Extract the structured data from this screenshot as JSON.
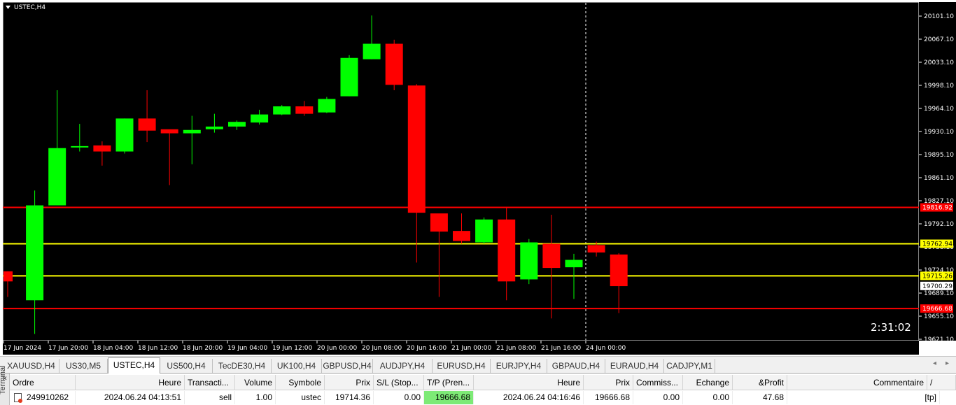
{
  "chart": {
    "symbol_label": "USTEC,H4",
    "countdown": "2:31:02",
    "colors": {
      "background": "#000000",
      "bull": "#00ff00",
      "bear": "#ff0000",
      "axis_text": "#ffffff",
      "crosshair": "#ffffff"
    },
    "price_ticks": [
      "20101.10",
      "20067.10",
      "20033.10",
      "19998.10",
      "19964.10",
      "19930.10",
      "19895.10",
      "19861.10",
      "19827.10",
      "19792.10",
      "19758.10",
      "19724.10",
      "19689.10",
      "19655.10",
      "19621.10"
    ],
    "time_ticks": [
      "17 Jun 2024",
      "17 Jun 20:00",
      "18 Jun 04:00",
      "18 Jun 12:00",
      "18 Jun 20:00",
      "19 Jun 04:00",
      "19 Jun 12:00",
      "20 Jun 00:00",
      "20 Jun 08:00",
      "20 Jun 16:00",
      "21 Jun 00:00",
      "21 Jun 08:00",
      "21 Jun 16:00",
      "24 Jun 00:00"
    ],
    "levels": [
      {
        "label": "19816.92",
        "price": 19816.92,
        "line_color": "#ff0000",
        "tag_bg": "#ff0000",
        "tag_fg": "#ffffff"
      },
      {
        "label": "19762.94",
        "price": 19762.94,
        "line_color": "#ffff00",
        "tag_bg": "#ffff00",
        "tag_fg": "#000000"
      },
      {
        "label": "19715.26",
        "price": 19715.26,
        "line_color": "#ffff00",
        "tag_bg": "#ffff00",
        "tag_fg": "#000000"
      },
      {
        "label": "19666.68",
        "price": 19666.68,
        "line_color": "#ff0000",
        "tag_bg": "#ff0000",
        "tag_fg": "#ffffff"
      }
    ],
    "current_price_tag": "19700.29"
  },
  "chart_data": {
    "type": "candlestick",
    "title": "USTEC,H4",
    "ylim": [
      19621.1,
      20101.1
    ],
    "candles": [
      {
        "o": 19722,
        "h": 19722,
        "l": 19684,
        "c": 19707
      },
      {
        "o": 19679,
        "h": 19842,
        "l": 19629,
        "c": 19820
      },
      {
        "o": 19820,
        "h": 19991,
        "l": 19820,
        "c": 19905
      },
      {
        "o": 19906,
        "h": 19941,
        "l": 19900,
        "c": 19908
      },
      {
        "o": 19909,
        "h": 19915,
        "l": 19879,
        "c": 19900
      },
      {
        "o": 19900,
        "h": 19949,
        "l": 19897,
        "c": 19949
      },
      {
        "o": 19949,
        "h": 19991,
        "l": 19914,
        "c": 19931
      },
      {
        "o": 19933,
        "h": 19932,
        "l": 19850,
        "c": 19927
      },
      {
        "o": 19927,
        "h": 19953,
        "l": 19881,
        "c": 19932
      },
      {
        "o": 19933,
        "h": 19956,
        "l": 19928,
        "c": 19937
      },
      {
        "o": 19937,
        "h": 19946,
        "l": 19932,
        "c": 19944
      },
      {
        "o": 19943,
        "h": 19962,
        "l": 19940,
        "c": 19955
      },
      {
        "o": 19955,
        "h": 19969,
        "l": 19954,
        "c": 19967
      },
      {
        "o": 19967,
        "h": 19975,
        "l": 19953,
        "c": 19956
      },
      {
        "o": 19958,
        "h": 19981,
        "l": 19957,
        "c": 19978
      },
      {
        "o": 19982,
        "h": 20043,
        "l": 19982,
        "c": 20039
      },
      {
        "o": 20037,
        "h": 20102,
        "l": 20037,
        "c": 20060
      },
      {
        "o": 20060,
        "h": 20066,
        "l": 19991,
        "c": 19999
      },
      {
        "o": 19998,
        "h": 20000,
        "l": 19735,
        "c": 19809
      },
      {
        "o": 19808,
        "h": 19806,
        "l": 19684,
        "c": 19781
      },
      {
        "o": 19782,
        "h": 19808,
        "l": 19763,
        "c": 19767
      },
      {
        "o": 19765,
        "h": 19802,
        "l": 19763,
        "c": 19799
      },
      {
        "o": 19799,
        "h": 19817,
        "l": 19679,
        "c": 19707
      },
      {
        "o": 19710,
        "h": 19770,
        "l": 19703,
        "c": 19765
      },
      {
        "o": 19763,
        "h": 19806,
        "l": 19652,
        "c": 19727
      },
      {
        "o": 19728,
        "h": 19748,
        "l": 19681,
        "c": 19739
      },
      {
        "o": 19761,
        "h": 19766,
        "l": 19744,
        "c": 19750
      },
      {
        "o": 19747,
        "h": 19749,
        "l": 19660,
        "c": 19700
      }
    ]
  },
  "tabs": {
    "items": [
      "XAUUSD,H4",
      "US30,M5",
      "USTEC,H4",
      "US500,H4",
      "TecDE30,H4",
      "UK100,H4",
      "GBPUSD,H4",
      "AUDJPY,H4",
      "EURUSD,H4",
      "EURJPY,H4",
      "GBPAUD,H4",
      "EURAUD,H4",
      "CADJPY,M1"
    ],
    "active_index": 2,
    "scroll_left": "◂",
    "scroll_right": "▸"
  },
  "terminal": {
    "side_label": "Terminal",
    "close_glyph": "✕",
    "headers": {
      "ordre": "Ordre",
      "heure": "Heure",
      "transaction": "Transacti...",
      "volume": "Volume",
      "symbole": "Symbole",
      "prix": "Prix",
      "sl": "S/L (Stop...",
      "tp": "T/P (Pren...",
      "heure2": "Heure",
      "prix2": "Prix",
      "commission": "Commiss...",
      "echange": "Echange",
      "profit": "&Profit",
      "commentaire": "Commentaire",
      "sort_glyph": "/"
    },
    "row": {
      "ordre": "249910262",
      "heure": "2024.06.24 04:13:51",
      "transaction": "sell",
      "volume": "1.00",
      "symbole": "ustec",
      "prix": "19714.36",
      "sl": "0.00",
      "tp": "19666.68",
      "heure2": "2024.06.24 04:16:46",
      "prix2": "19666.68",
      "commission": "0.00",
      "echange": "0.00",
      "profit": "47.68",
      "commentaire": "[tp]"
    }
  }
}
